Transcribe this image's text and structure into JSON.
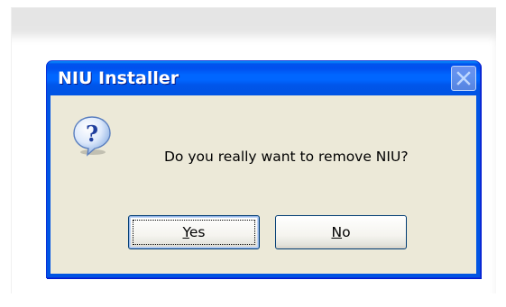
{
  "dialog": {
    "title": "NIU Installer",
    "message": "Do you really want to remove NIU?",
    "icon": "question-icon",
    "close_icon": "close-icon"
  },
  "buttons": {
    "yes": {
      "mnemonic": "Y",
      "rest": "es"
    },
    "no": {
      "mnemonic": "N",
      "rest": "o"
    }
  },
  "colors": {
    "titlebar": "#0054e3",
    "client_background": "#ece9d8",
    "title_text": "#ffffff"
  }
}
